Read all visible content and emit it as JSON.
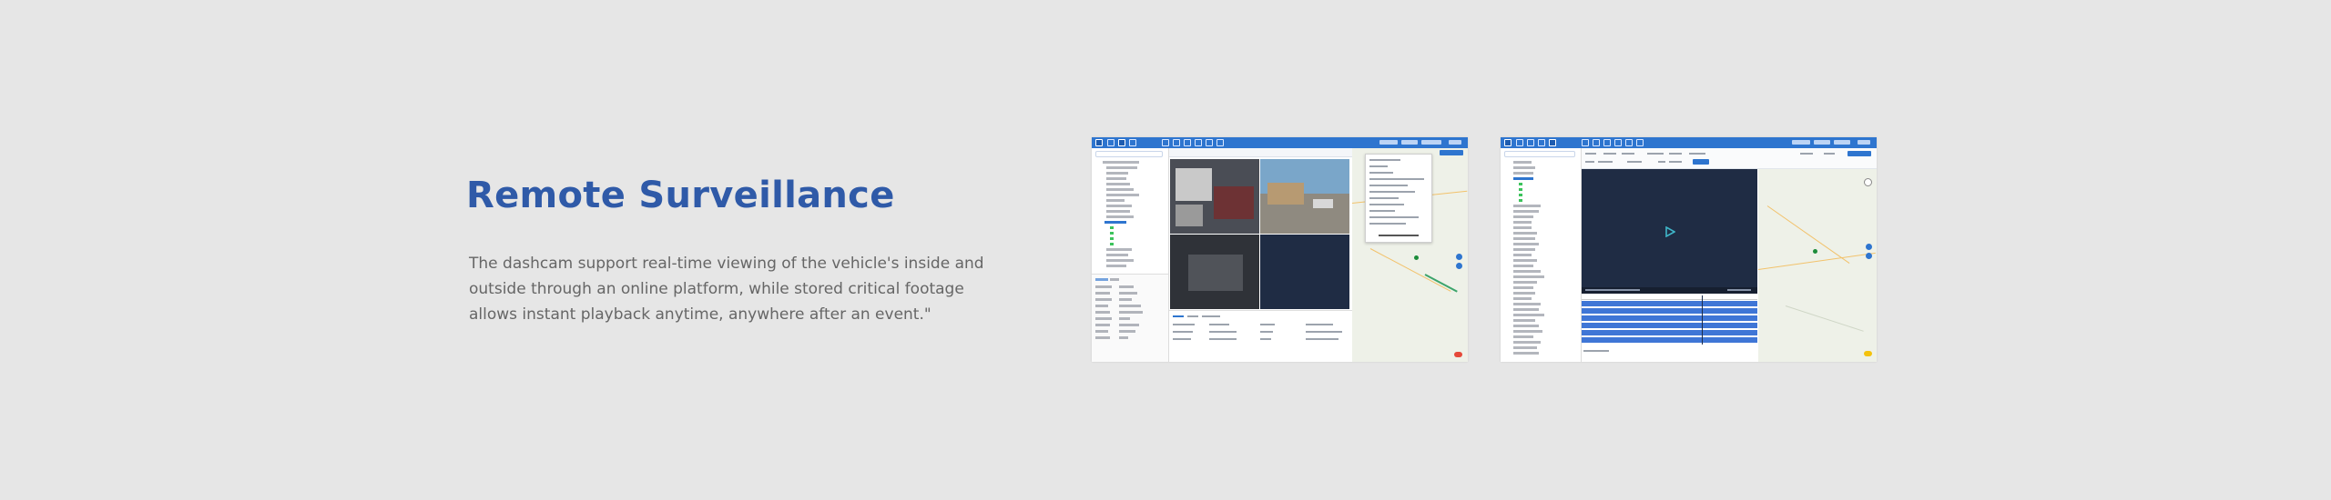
{
  "hero": {
    "title": "Remote Surveillance",
    "description": "The dashcam support real-time viewing of the vehicle's inside and outside through an online platform, while stored critical footage allows instant playback anytime, anywhere after an event.\""
  },
  "colors": {
    "background": "#e6e6e6",
    "title": "#2f5aa8",
    "body_text": "#666666",
    "app_bar": "#2e75cf",
    "video_bg": "#2a2e36",
    "playback_bg": "#1f2c44",
    "timeline_bar": "#3f76d6"
  },
  "screenshots": [
    {
      "name": "live-view-screenshot"
    },
    {
      "name": "playback-screenshot",
      "center_icon": "play-icon"
    }
  ]
}
